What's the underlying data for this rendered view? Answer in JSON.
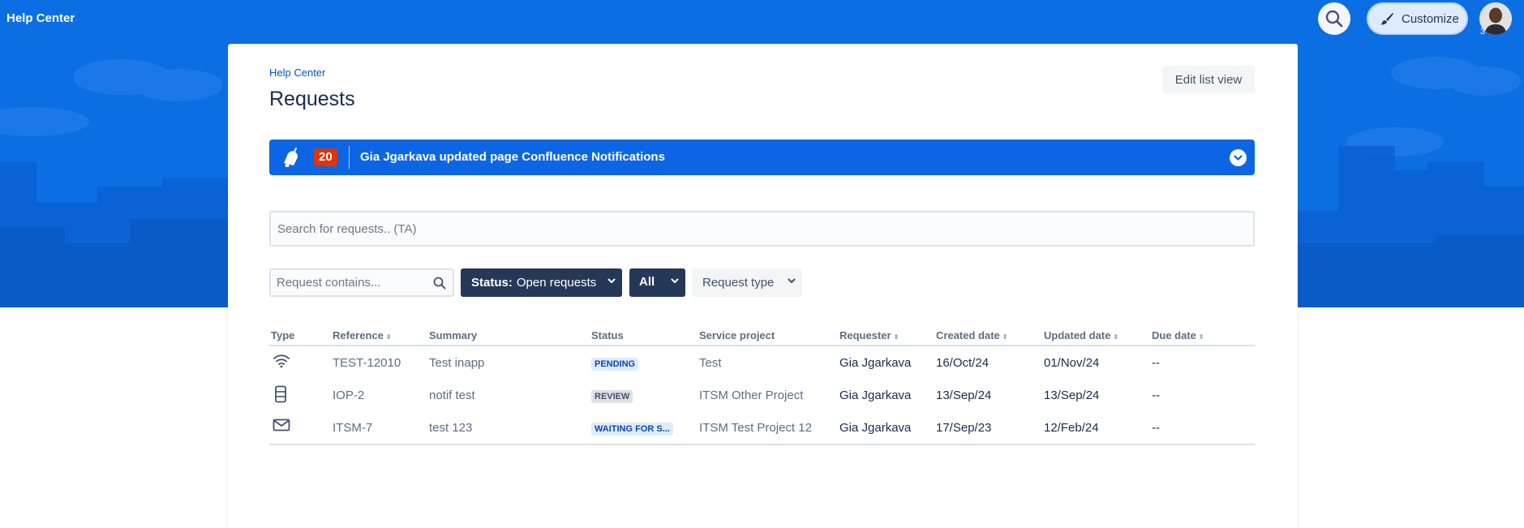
{
  "header": {
    "brand": "Help Center",
    "customize_label": "Customize",
    "avatar_badge": "3"
  },
  "page": {
    "breadcrumb": "Help Center",
    "title": "Requests",
    "edit_list_label": "Edit list view"
  },
  "notification": {
    "count": "20",
    "text": "Gia Jgarkava updated page Confluence Notifications"
  },
  "search": {
    "placeholder": "Search for requests.. (TA)"
  },
  "filters": {
    "contains_placeholder": "Request contains...",
    "status_prefix": "Status:",
    "status_value": "Open requests",
    "scope": "All",
    "request_type": "Request type"
  },
  "table": {
    "columns": [
      "Type",
      "Reference",
      "Summary",
      "Status",
      "Service project",
      "Requester",
      "Created date",
      "Updated date",
      "Due date"
    ],
    "rows": [
      {
        "type_icon": "wifi-icon",
        "reference": "TEST-12010",
        "summary": "Test inapp",
        "status": "PENDING",
        "status_color": "#deebff",
        "project": "Test",
        "requester": "Gia Jgarkava",
        "created": "16/Oct/24",
        "updated": "01/Nov/24",
        "due": "--"
      },
      {
        "type_icon": "server-icon",
        "reference": "IOP-2",
        "summary": "notif test",
        "status": "REVIEW",
        "status_color": "#dfe1e6",
        "project": "ITSM Other Project",
        "requester": "Gia Jgarkava",
        "created": "13/Sep/24",
        "updated": "13/Sep/24",
        "due": "--"
      },
      {
        "type_icon": "mail-icon",
        "reference": "ITSM-7",
        "summary": "test 123",
        "status": "WAITING FOR S...",
        "status_color": "#deebff",
        "project": "ITSM Test Project 12",
        "requester": "Gia Jgarkava",
        "created": "17/Sep/23",
        "updated": "12/Feb/24",
        "due": "--"
      }
    ]
  },
  "colors": {
    "hero_blue": "#0b6ee3",
    "banner_blue": "#0c66e4",
    "navy": "#253858",
    "badge_red": "#de350b"
  }
}
